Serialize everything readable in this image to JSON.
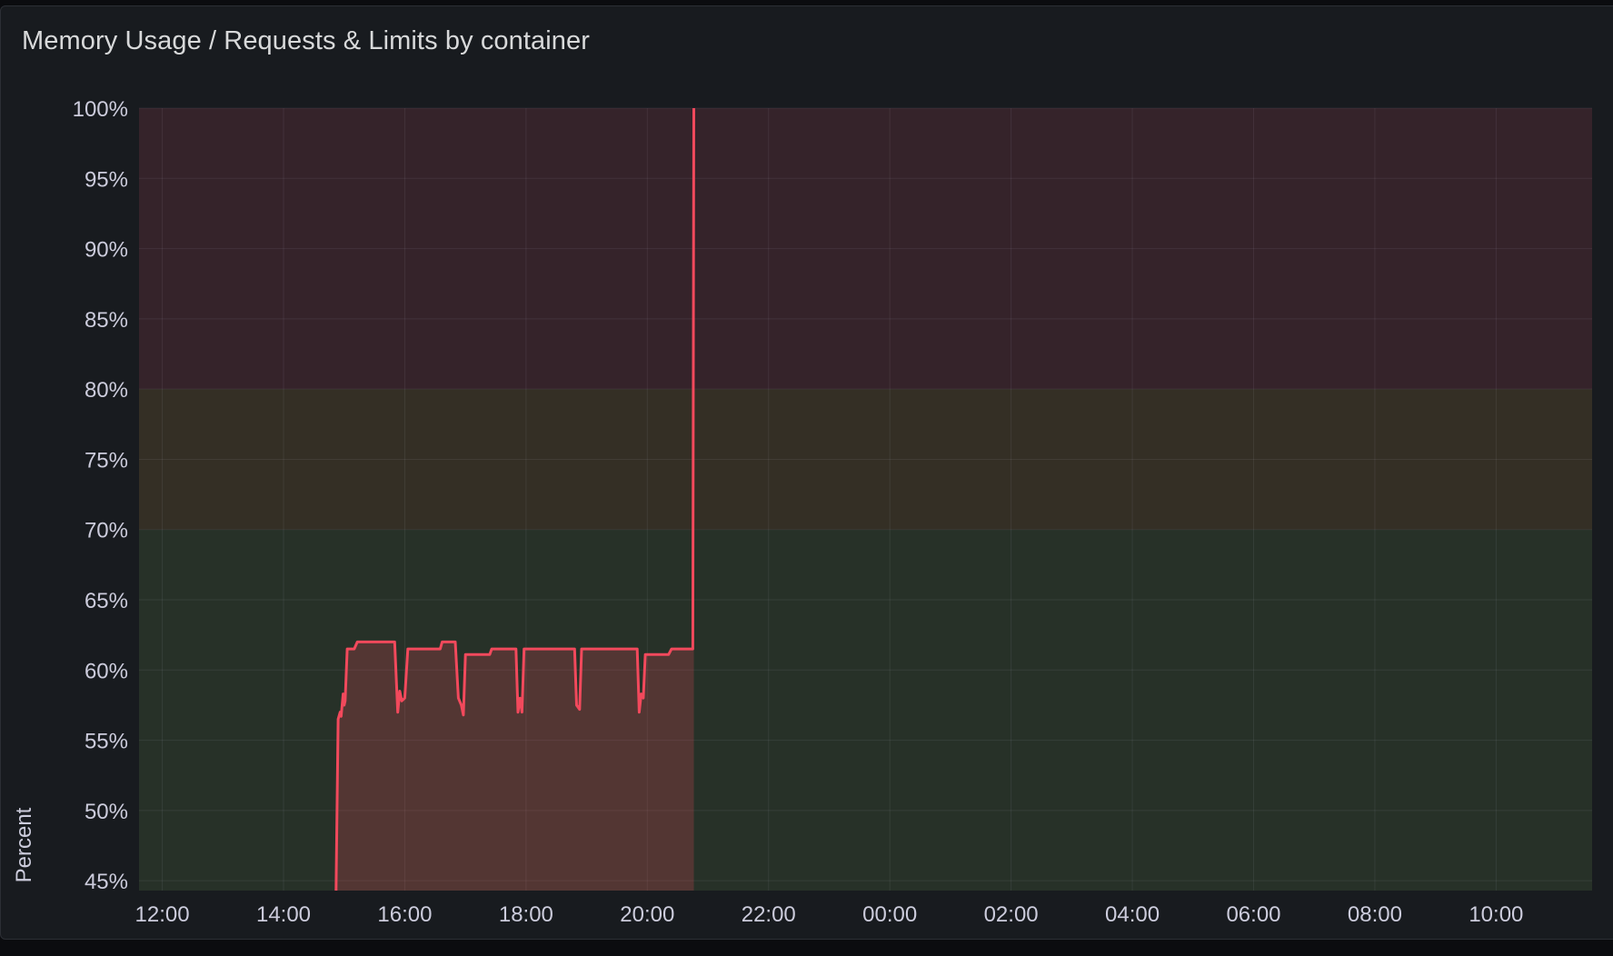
{
  "panel": {
    "title": "Memory Usage / Requests & Limits by container"
  },
  "chart_data": {
    "type": "area",
    "title": "Memory Usage / Requests & Limits by container",
    "ylabel": "Percent",
    "xlabel": "",
    "ylim": [
      44.3,
      100
    ],
    "xlim": [
      "11:37",
      "11:35"
    ],
    "x_ticks": [
      "12:00",
      "14:00",
      "16:00",
      "18:00",
      "20:00",
      "22:00",
      "00:00",
      "02:00",
      "04:00",
      "06:00",
      "08:00",
      "10:00"
    ],
    "y_ticks": [
      "100%",
      "95%",
      "90%",
      "85%",
      "80%",
      "75%",
      "70%",
      "65%",
      "60%",
      "55%",
      "50%",
      "45%"
    ],
    "grid": true,
    "thresholds": [
      {
        "from": 0,
        "to": 70,
        "color": "#273128"
      },
      {
        "from": 70,
        "to": 80,
        "color": "#342f25"
      },
      {
        "from": 80,
        "to": 100,
        "color": "#35232a"
      }
    ],
    "series": [
      {
        "color": "#f2495c",
        "points": [
          [
            "14:52",
            44.3
          ],
          [
            "14:54",
            56.5
          ],
          [
            "14:56",
            57
          ],
          [
            "14:57",
            56.7
          ],
          [
            "14:59",
            58.3
          ],
          [
            "15:00",
            57.5
          ],
          [
            "15:01",
            57.8
          ],
          [
            "15:03",
            61.5
          ],
          [
            "15:10",
            61.5
          ],
          [
            "15:13",
            62
          ],
          [
            "15:50",
            62
          ],
          [
            "15:53",
            57
          ],
          [
            "15:55",
            58.5
          ],
          [
            "15:57",
            57.8
          ],
          [
            "16:00",
            58
          ],
          [
            "16:03",
            61.5
          ],
          [
            "16:35",
            61.5
          ],
          [
            "16:37",
            62
          ],
          [
            "16:50",
            62
          ],
          [
            "16:53",
            58
          ],
          [
            "16:56",
            57.5
          ],
          [
            "16:58",
            56.8
          ],
          [
            "17:00",
            61.1
          ],
          [
            "17:24",
            61.1
          ],
          [
            "17:26",
            61.5
          ],
          [
            "17:50",
            61.5
          ],
          [
            "17:52",
            57
          ],
          [
            "17:54",
            58
          ],
          [
            "17:56",
            57
          ],
          [
            "17:58",
            61.5
          ],
          [
            "18:48",
            61.5
          ],
          [
            "18:50",
            57.5
          ],
          [
            "18:53",
            57.2
          ],
          [
            "18:55",
            61.5
          ],
          [
            "19:50",
            61.5
          ],
          [
            "19:52",
            57
          ],
          [
            "19:54",
            58.3
          ],
          [
            "19:56",
            58
          ],
          [
            "19:58",
            61.1
          ],
          [
            "20:21",
            61.1
          ],
          [
            "20:24",
            61.5
          ],
          [
            "20:45",
            61.5
          ],
          [
            "20:46",
            100
          ]
        ]
      }
    ]
  }
}
